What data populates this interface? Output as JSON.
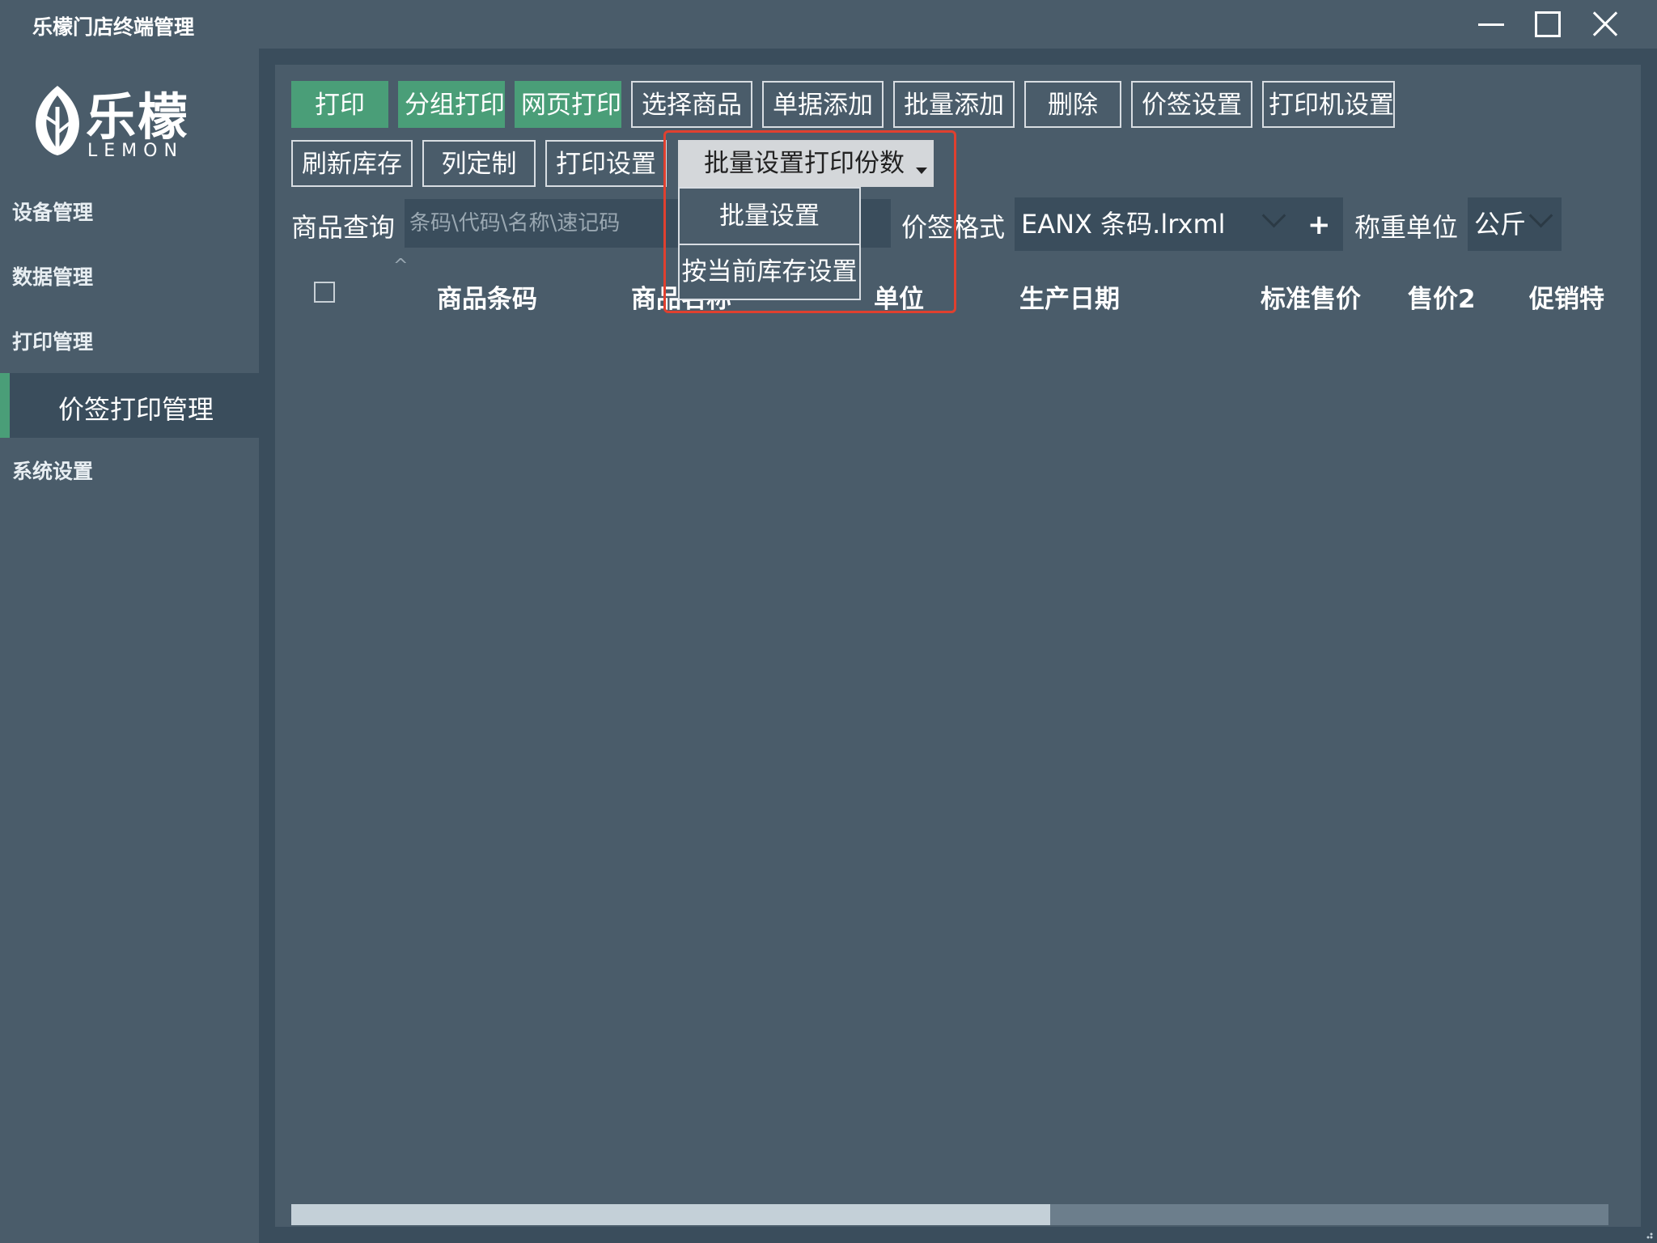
{
  "window": {
    "title": "乐檬门店终端管理"
  },
  "logo": {
    "text_cn": "乐檬",
    "text_en": "LEMON"
  },
  "sidebar": {
    "items": [
      {
        "label": "设备管理"
      },
      {
        "label": "数据管理"
      },
      {
        "label": "打印管理"
      },
      {
        "label": "价签打印管理"
      },
      {
        "label": "系统设置"
      }
    ]
  },
  "toolbar": {
    "row1": [
      {
        "label": "打印"
      },
      {
        "label": "分组打印"
      },
      {
        "label": "网页打印"
      },
      {
        "label": "选择商品"
      },
      {
        "label": "单据添加"
      },
      {
        "label": "批量添加"
      },
      {
        "label": "删除"
      },
      {
        "label": "价签设置"
      },
      {
        "label": "打印机设置"
      }
    ],
    "row2": [
      {
        "label": "刷新库存"
      },
      {
        "label": "列定制"
      },
      {
        "label": "打印设置"
      }
    ],
    "dropdown": {
      "label": "批量设置打印份数",
      "items": [
        {
          "label": "批量设置"
        },
        {
          "label": "按当前库存设置"
        }
      ]
    }
  },
  "search": {
    "label": "商品查询",
    "placeholder": "条码\\代码\\名称\\速记码"
  },
  "label_format": {
    "label": "价签格式",
    "value": "EANX 条码.lrxml",
    "add": "+"
  },
  "weight_unit": {
    "label": "称重单位",
    "value": "公斤"
  },
  "table": {
    "columns": [
      "商品条码",
      "商品名称",
      "单位",
      "生产日期",
      "标准售价",
      "售价2",
      "促销特"
    ],
    "rows": []
  },
  "colors": {
    "background": "#4a5c6a",
    "panel_border": "#3a4d5c",
    "accent_green": "#4a9e78",
    "highlight_red": "#e0402f"
  },
  "scrollbar": {
    "horizontal_position": 0.0,
    "visible_fraction": 0.58
  }
}
